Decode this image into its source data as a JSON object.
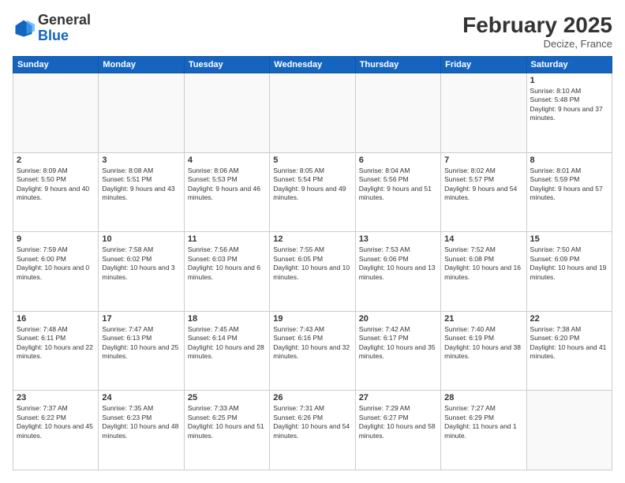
{
  "header": {
    "logo_general": "General",
    "logo_blue": "Blue",
    "month": "February 2025",
    "location": "Decize, France"
  },
  "weekdays": [
    "Sunday",
    "Monday",
    "Tuesday",
    "Wednesday",
    "Thursday",
    "Friday",
    "Saturday"
  ],
  "weeks": [
    [
      {
        "day": "",
        "info": ""
      },
      {
        "day": "",
        "info": ""
      },
      {
        "day": "",
        "info": ""
      },
      {
        "day": "",
        "info": ""
      },
      {
        "day": "",
        "info": ""
      },
      {
        "day": "",
        "info": ""
      },
      {
        "day": "1",
        "info": "Sunrise: 8:10 AM\nSunset: 5:48 PM\nDaylight: 9 hours and 37 minutes."
      }
    ],
    [
      {
        "day": "2",
        "info": "Sunrise: 8:09 AM\nSunset: 5:50 PM\nDaylight: 9 hours and 40 minutes."
      },
      {
        "day": "3",
        "info": "Sunrise: 8:08 AM\nSunset: 5:51 PM\nDaylight: 9 hours and 43 minutes."
      },
      {
        "day": "4",
        "info": "Sunrise: 8:06 AM\nSunset: 5:53 PM\nDaylight: 9 hours and 46 minutes."
      },
      {
        "day": "5",
        "info": "Sunrise: 8:05 AM\nSunset: 5:54 PM\nDaylight: 9 hours and 49 minutes."
      },
      {
        "day": "6",
        "info": "Sunrise: 8:04 AM\nSunset: 5:56 PM\nDaylight: 9 hours and 51 minutes."
      },
      {
        "day": "7",
        "info": "Sunrise: 8:02 AM\nSunset: 5:57 PM\nDaylight: 9 hours and 54 minutes."
      },
      {
        "day": "8",
        "info": "Sunrise: 8:01 AM\nSunset: 5:59 PM\nDaylight: 9 hours and 57 minutes."
      }
    ],
    [
      {
        "day": "9",
        "info": "Sunrise: 7:59 AM\nSunset: 6:00 PM\nDaylight: 10 hours and 0 minutes."
      },
      {
        "day": "10",
        "info": "Sunrise: 7:58 AM\nSunset: 6:02 PM\nDaylight: 10 hours and 3 minutes."
      },
      {
        "day": "11",
        "info": "Sunrise: 7:56 AM\nSunset: 6:03 PM\nDaylight: 10 hours and 6 minutes."
      },
      {
        "day": "12",
        "info": "Sunrise: 7:55 AM\nSunset: 6:05 PM\nDaylight: 10 hours and 10 minutes."
      },
      {
        "day": "13",
        "info": "Sunrise: 7:53 AM\nSunset: 6:06 PM\nDaylight: 10 hours and 13 minutes."
      },
      {
        "day": "14",
        "info": "Sunrise: 7:52 AM\nSunset: 6:08 PM\nDaylight: 10 hours and 16 minutes."
      },
      {
        "day": "15",
        "info": "Sunrise: 7:50 AM\nSunset: 6:09 PM\nDaylight: 10 hours and 19 minutes."
      }
    ],
    [
      {
        "day": "16",
        "info": "Sunrise: 7:48 AM\nSunset: 6:11 PM\nDaylight: 10 hours and 22 minutes."
      },
      {
        "day": "17",
        "info": "Sunrise: 7:47 AM\nSunset: 6:13 PM\nDaylight: 10 hours and 25 minutes."
      },
      {
        "day": "18",
        "info": "Sunrise: 7:45 AM\nSunset: 6:14 PM\nDaylight: 10 hours and 28 minutes."
      },
      {
        "day": "19",
        "info": "Sunrise: 7:43 AM\nSunset: 6:16 PM\nDaylight: 10 hours and 32 minutes."
      },
      {
        "day": "20",
        "info": "Sunrise: 7:42 AM\nSunset: 6:17 PM\nDaylight: 10 hours and 35 minutes."
      },
      {
        "day": "21",
        "info": "Sunrise: 7:40 AM\nSunset: 6:19 PM\nDaylight: 10 hours and 38 minutes."
      },
      {
        "day": "22",
        "info": "Sunrise: 7:38 AM\nSunset: 6:20 PM\nDaylight: 10 hours and 41 minutes."
      }
    ],
    [
      {
        "day": "23",
        "info": "Sunrise: 7:37 AM\nSunset: 6:22 PM\nDaylight: 10 hours and 45 minutes."
      },
      {
        "day": "24",
        "info": "Sunrise: 7:35 AM\nSunset: 6:23 PM\nDaylight: 10 hours and 48 minutes."
      },
      {
        "day": "25",
        "info": "Sunrise: 7:33 AM\nSunset: 6:25 PM\nDaylight: 10 hours and 51 minutes."
      },
      {
        "day": "26",
        "info": "Sunrise: 7:31 AM\nSunset: 6:26 PM\nDaylight: 10 hours and 54 minutes."
      },
      {
        "day": "27",
        "info": "Sunrise: 7:29 AM\nSunset: 6:27 PM\nDaylight: 10 hours and 58 minutes."
      },
      {
        "day": "28",
        "info": "Sunrise: 7:27 AM\nSunset: 6:29 PM\nDaylight: 11 hours and 1 minute."
      },
      {
        "day": "",
        "info": ""
      }
    ]
  ]
}
